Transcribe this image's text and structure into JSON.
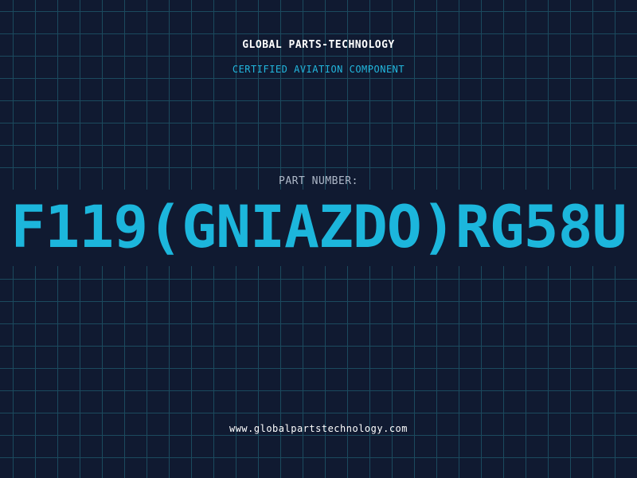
{
  "header": {
    "company": "GLOBAL PARTS-TECHNOLOGY",
    "subtitle": "CERTIFIED AVIATION COMPONENT"
  },
  "part": {
    "label": "PART NUMBER:",
    "number": "F119(GNIAZDO)RG58U"
  },
  "footer": {
    "website": "www.globalpartstechnology.com"
  },
  "colors": {
    "background": "#101a31",
    "grid": "#1b4a5e",
    "accent": "#1cb6dc",
    "label": "#aeb8c8",
    "text": "#ffffff"
  }
}
